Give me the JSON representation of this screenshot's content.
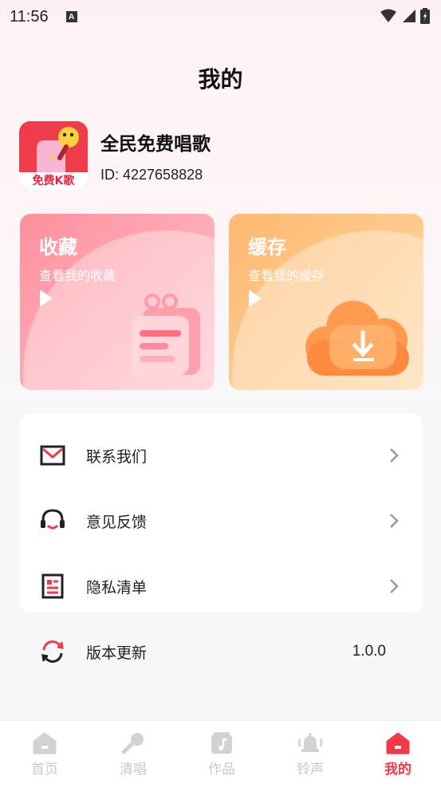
{
  "status_bar": {
    "time": "11:56",
    "notification_letter": "A"
  },
  "header": {
    "title": "我的"
  },
  "profile": {
    "name": "全民免费唱歌",
    "id_text": "ID: 4227658828",
    "avatar_text": "免费K歌"
  },
  "cards": {
    "favorites": {
      "title": "收藏",
      "subtitle": "查看我的收藏"
    },
    "cache": {
      "title": "缓存",
      "subtitle": "查看我的缓存"
    }
  },
  "menu": {
    "items": [
      {
        "label": "联系我们",
        "icon": "mail-icon"
      },
      {
        "label": "意见反馈",
        "icon": "headset-icon"
      },
      {
        "label": "隐私清单",
        "icon": "document-list-icon"
      },
      {
        "label": "版本更新",
        "icon": "refresh-icon",
        "value": "1.0.0"
      }
    ]
  },
  "bottom_nav": {
    "items": [
      {
        "label": "首页",
        "icon": "home-icon"
      },
      {
        "label": "清唱",
        "icon": "microphone-icon"
      },
      {
        "label": "作品",
        "icon": "music-note-icon"
      },
      {
        "label": "铃声",
        "icon": "bell-icon"
      },
      {
        "label": "我的",
        "icon": "home-icon"
      }
    ],
    "active_index": 4
  },
  "colors": {
    "accent": "#f03a48",
    "card_fav": "#ff8f9c",
    "card_cache": "#ffb870",
    "inactive": "#c8c8c8"
  }
}
